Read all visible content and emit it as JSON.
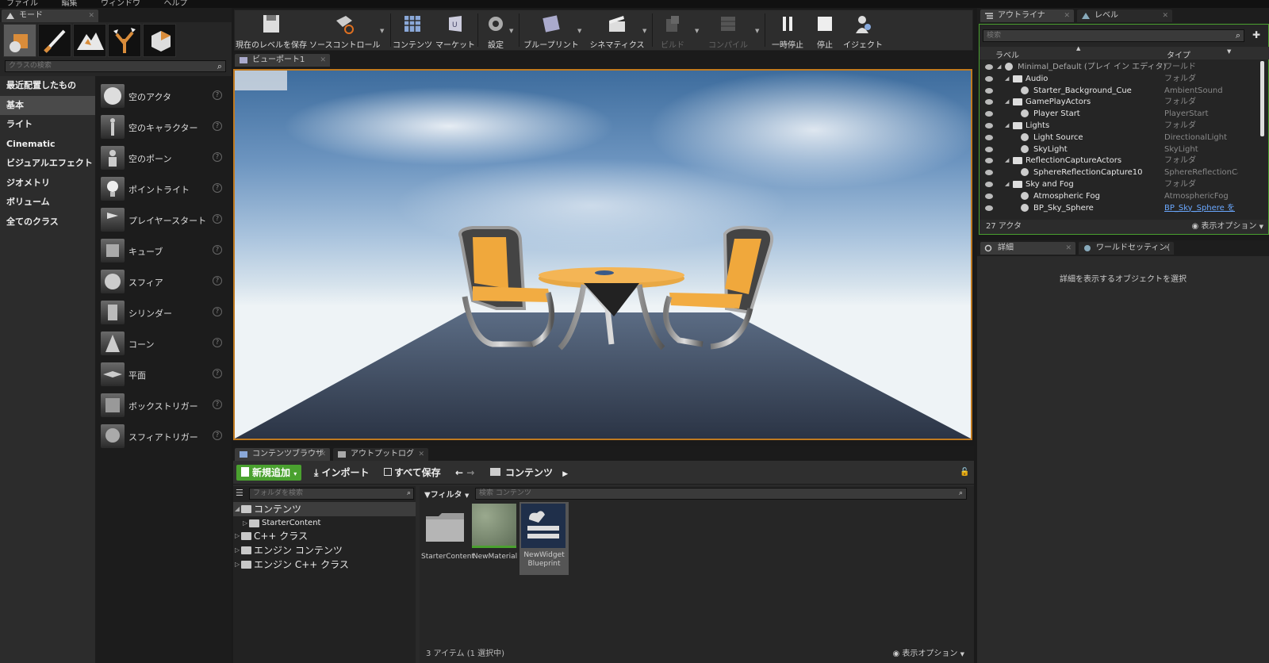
{
  "menubar": {
    "items": [
      "ファイル",
      "編集",
      "ウィンドウ",
      "ヘルプ"
    ]
  },
  "modes": {
    "tab_label": "モード",
    "search_placeholder": "クラスの検索",
    "categories": [
      "最近配置したもの",
      "基本",
      "ライト",
      "Cinematic",
      "ビジュアルエフェクト",
      "ジオメトリ",
      "ボリューム",
      "全てのクラス"
    ],
    "actors": [
      "空のアクタ",
      "空のキャラクター",
      "空のポーン",
      "ポイントライト",
      "プレイヤースタート",
      "キューブ",
      "スフィア",
      "シリンダー",
      "コーン",
      "平面",
      "ボックストリガー",
      "スフィアトリガー"
    ]
  },
  "toolbar": {
    "buttons": [
      "現在のレベルを保存",
      "ソースコントロール",
      "コンテンツ",
      "マーケット",
      "設定",
      "ブループリント",
      "シネマティクス",
      "ビルド",
      "コンパイル",
      "一時停止",
      "停止",
      "イジェクト"
    ]
  },
  "viewport": {
    "tab_label": "ビューポート1"
  },
  "content_browser": {
    "tabs": [
      "コンテンツブラウザ",
      "アウトプットログ"
    ],
    "add_new": "新規追加",
    "import": "インポート",
    "save_all": "すべて保存",
    "path": "コンテンツ",
    "folder_search_placeholder": "フォルダを検索",
    "filter": "フィルタ",
    "asset_search_placeholder": "検索 コンテンツ",
    "tree": [
      "コンテンツ",
      "StarterContent",
      "C++ クラス",
      "エンジン コンテンツ",
      "エンジン C++ クラス"
    ],
    "assets": [
      "StarterContent",
      "NewMaterial",
      "NewWidget Blueprint"
    ],
    "status": "3 アイテム (1 選択中)",
    "view_options": "表示オプション"
  },
  "outliner": {
    "tabs": [
      "アウトライナ",
      "レベル"
    ],
    "search_placeholder": "検索",
    "col_label": "ラベル",
    "col_type": "タイプ",
    "rows": [
      {
        "name": "Minimal_Default (プレイ イン エディタ)",
        "type": "ワールド"
      },
      {
        "name": "Audio",
        "type": "フォルダ"
      },
      {
        "name": "Starter_Background_Cue",
        "type": "AmbientSound"
      },
      {
        "name": "GamePlayActors",
        "type": "フォルダ"
      },
      {
        "name": "Player Start",
        "type": "PlayerStart"
      },
      {
        "name": "Lights",
        "type": "フォルダ"
      },
      {
        "name": "Light Source",
        "type": "DirectionalLight"
      },
      {
        "name": "SkyLight",
        "type": "SkyLight"
      },
      {
        "name": "ReflectionCaptureActors",
        "type": "フォルダ"
      },
      {
        "name": "SphereReflectionCapture10",
        "type": "SphereReflectionCa"
      },
      {
        "name": "Sky and Fog",
        "type": "フォルダ"
      },
      {
        "name": "Atmospheric Fog",
        "type": "AtmosphericFog"
      },
      {
        "name": "BP_Sky_Sphere",
        "type": "BP_Sky_Sphere を"
      }
    ],
    "actor_count": "27 アクタ",
    "view_options": "表示オプション"
  },
  "details": {
    "tabs": [
      "詳細",
      "ワールドセッティン("
    ],
    "empty_text": "詳細を表示するオブジェクトを選択"
  },
  "colors": {
    "accent_green": "#4aa12f",
    "viewport_border": "#c07a20"
  }
}
